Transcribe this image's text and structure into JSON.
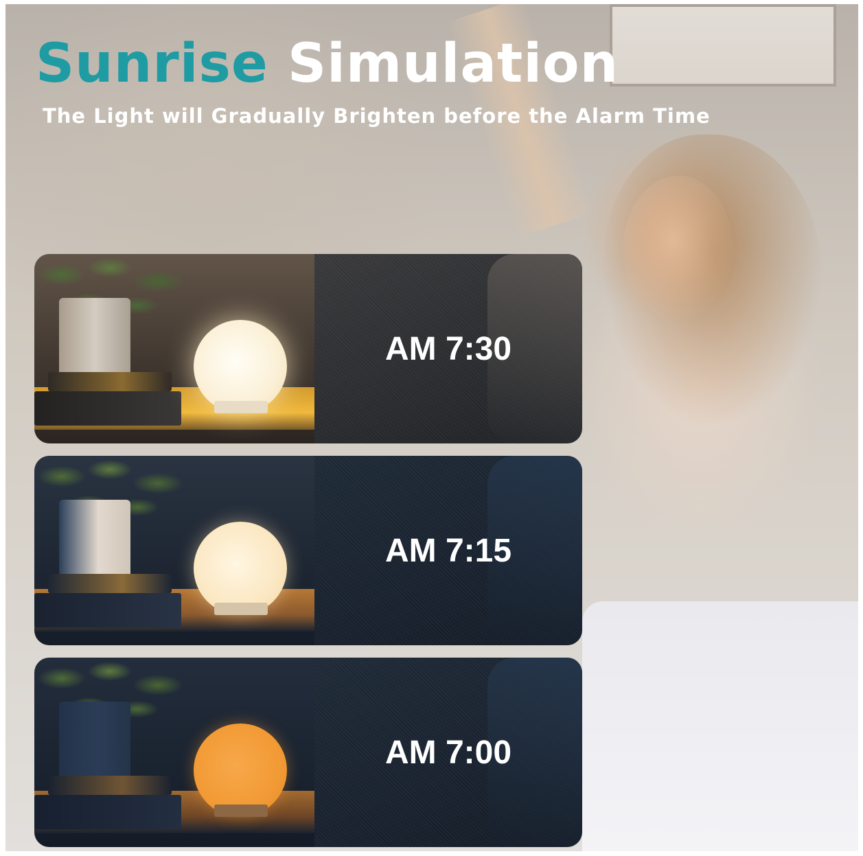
{
  "header": {
    "title_accent": "Sunrise",
    "title_rest": "Simulation",
    "subtitle": "The Light will Gradually Brighten before the Alarm Time"
  },
  "colors": {
    "accent": "#1f9ba3",
    "text": "#ffffff"
  },
  "panels": [
    {
      "time": "AM 7:30",
      "brightness": "bright"
    },
    {
      "time": "AM 7:15",
      "brightness": "medium"
    },
    {
      "time": "AM 7:00",
      "brightness": "dim"
    }
  ]
}
